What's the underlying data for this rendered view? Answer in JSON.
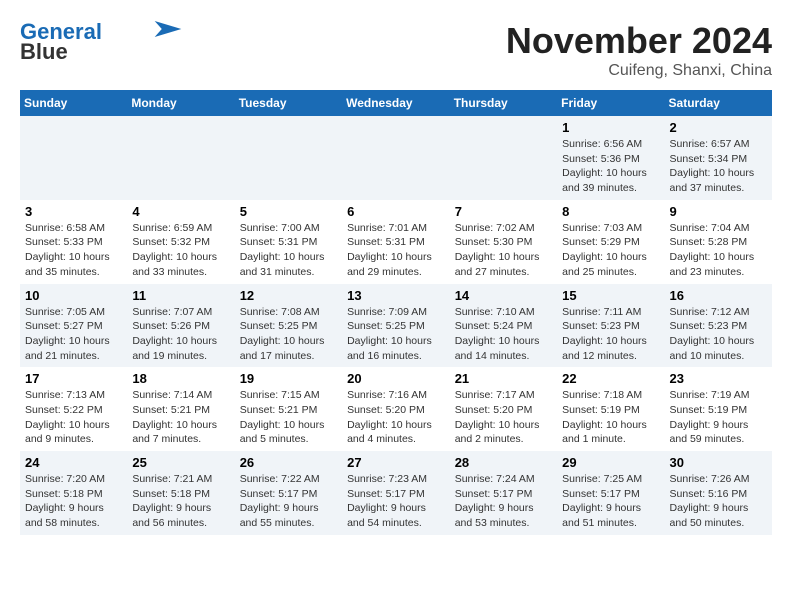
{
  "logo": {
    "line1": "General",
    "line2": "Blue"
  },
  "header": {
    "month": "November 2024",
    "location": "Cuifeng, Shanxi, China"
  },
  "weekdays": [
    "Sunday",
    "Monday",
    "Tuesday",
    "Wednesday",
    "Thursday",
    "Friday",
    "Saturday"
  ],
  "weeks": [
    [
      {
        "day": "",
        "info": ""
      },
      {
        "day": "",
        "info": ""
      },
      {
        "day": "",
        "info": ""
      },
      {
        "day": "",
        "info": ""
      },
      {
        "day": "",
        "info": ""
      },
      {
        "day": "1",
        "info": "Sunrise: 6:56 AM\nSunset: 5:36 PM\nDaylight: 10 hours\nand 39 minutes."
      },
      {
        "day": "2",
        "info": "Sunrise: 6:57 AM\nSunset: 5:34 PM\nDaylight: 10 hours\nand 37 minutes."
      }
    ],
    [
      {
        "day": "3",
        "info": "Sunrise: 6:58 AM\nSunset: 5:33 PM\nDaylight: 10 hours\nand 35 minutes."
      },
      {
        "day": "4",
        "info": "Sunrise: 6:59 AM\nSunset: 5:32 PM\nDaylight: 10 hours\nand 33 minutes."
      },
      {
        "day": "5",
        "info": "Sunrise: 7:00 AM\nSunset: 5:31 PM\nDaylight: 10 hours\nand 31 minutes."
      },
      {
        "day": "6",
        "info": "Sunrise: 7:01 AM\nSunset: 5:31 PM\nDaylight: 10 hours\nand 29 minutes."
      },
      {
        "day": "7",
        "info": "Sunrise: 7:02 AM\nSunset: 5:30 PM\nDaylight: 10 hours\nand 27 minutes."
      },
      {
        "day": "8",
        "info": "Sunrise: 7:03 AM\nSunset: 5:29 PM\nDaylight: 10 hours\nand 25 minutes."
      },
      {
        "day": "9",
        "info": "Sunrise: 7:04 AM\nSunset: 5:28 PM\nDaylight: 10 hours\nand 23 minutes."
      }
    ],
    [
      {
        "day": "10",
        "info": "Sunrise: 7:05 AM\nSunset: 5:27 PM\nDaylight: 10 hours\nand 21 minutes."
      },
      {
        "day": "11",
        "info": "Sunrise: 7:07 AM\nSunset: 5:26 PM\nDaylight: 10 hours\nand 19 minutes."
      },
      {
        "day": "12",
        "info": "Sunrise: 7:08 AM\nSunset: 5:25 PM\nDaylight: 10 hours\nand 17 minutes."
      },
      {
        "day": "13",
        "info": "Sunrise: 7:09 AM\nSunset: 5:25 PM\nDaylight: 10 hours\nand 16 minutes."
      },
      {
        "day": "14",
        "info": "Sunrise: 7:10 AM\nSunset: 5:24 PM\nDaylight: 10 hours\nand 14 minutes."
      },
      {
        "day": "15",
        "info": "Sunrise: 7:11 AM\nSunset: 5:23 PM\nDaylight: 10 hours\nand 12 minutes."
      },
      {
        "day": "16",
        "info": "Sunrise: 7:12 AM\nSunset: 5:23 PM\nDaylight: 10 hours\nand 10 minutes."
      }
    ],
    [
      {
        "day": "17",
        "info": "Sunrise: 7:13 AM\nSunset: 5:22 PM\nDaylight: 10 hours\nand 9 minutes."
      },
      {
        "day": "18",
        "info": "Sunrise: 7:14 AM\nSunset: 5:21 PM\nDaylight: 10 hours\nand 7 minutes."
      },
      {
        "day": "19",
        "info": "Sunrise: 7:15 AM\nSunset: 5:21 PM\nDaylight: 10 hours\nand 5 minutes."
      },
      {
        "day": "20",
        "info": "Sunrise: 7:16 AM\nSunset: 5:20 PM\nDaylight: 10 hours\nand 4 minutes."
      },
      {
        "day": "21",
        "info": "Sunrise: 7:17 AM\nSunset: 5:20 PM\nDaylight: 10 hours\nand 2 minutes."
      },
      {
        "day": "22",
        "info": "Sunrise: 7:18 AM\nSunset: 5:19 PM\nDaylight: 10 hours\nand 1 minute."
      },
      {
        "day": "23",
        "info": "Sunrise: 7:19 AM\nSunset: 5:19 PM\nDaylight: 9 hours\nand 59 minutes."
      }
    ],
    [
      {
        "day": "24",
        "info": "Sunrise: 7:20 AM\nSunset: 5:18 PM\nDaylight: 9 hours\nand 58 minutes."
      },
      {
        "day": "25",
        "info": "Sunrise: 7:21 AM\nSunset: 5:18 PM\nDaylight: 9 hours\nand 56 minutes."
      },
      {
        "day": "26",
        "info": "Sunrise: 7:22 AM\nSunset: 5:17 PM\nDaylight: 9 hours\nand 55 minutes."
      },
      {
        "day": "27",
        "info": "Sunrise: 7:23 AM\nSunset: 5:17 PM\nDaylight: 9 hours\nand 54 minutes."
      },
      {
        "day": "28",
        "info": "Sunrise: 7:24 AM\nSunset: 5:17 PM\nDaylight: 9 hours\nand 53 minutes."
      },
      {
        "day": "29",
        "info": "Sunrise: 7:25 AM\nSunset: 5:17 PM\nDaylight: 9 hours\nand 51 minutes."
      },
      {
        "day": "30",
        "info": "Sunrise: 7:26 AM\nSunset: 5:16 PM\nDaylight: 9 hours\nand 50 minutes."
      }
    ]
  ]
}
